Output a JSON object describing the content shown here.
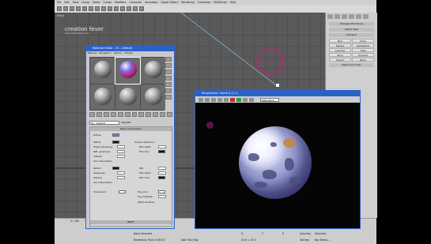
{
  "menubar": {
    "items": [
      "File",
      "Edit",
      "Tools",
      "Group",
      "Views",
      "Create",
      "Modifiers",
      "Character",
      "Animation",
      "Graph Editors",
      "Rendering",
      "Customize",
      "MAXScript",
      "Help"
    ]
  },
  "viewport": {
    "label": "Front",
    "logo_text": "creation fever",
    "logo_subtext": "www.creationfever.com"
  },
  "command_panel": {
    "dropdown": "Standard Primitives",
    "section": "Object Type",
    "autogrid": "AutoGrid",
    "buttons": [
      "Box",
      "Cone",
      "Sphere",
      "GeoSphere",
      "Cylinder",
      "Tube",
      "Torus",
      "Pyramid",
      "Teapot",
      "Plane"
    ],
    "section2": "Name and Color"
  },
  "material_editor": {
    "title": "Material Editor - 01 - Default",
    "menu": [
      "Material",
      "Navigation",
      "Options",
      "Utilities"
    ],
    "name_field": "01 - Default",
    "type_tag": "VRayMtl",
    "rollout_basic": "Basic parameters",
    "diffuse_label": "Diffuse",
    "reflect_label": "Reflect",
    "hilight_label": "Hilight glossiness",
    "refl_gloss_label": "Refl. glossiness",
    "subdivs_label": "Subdivs",
    "fresnel_label": "Fresnel reflections",
    "max_depth_label": "Max depth",
    "exit_color_label": "Exit color",
    "use_interp_label": "Use interpolation",
    "refract_label": "Refract",
    "ior_label": "IOR",
    "glossiness_label": "Glossiness",
    "translucent_label": "Translucent",
    "fog_color_label": "Fog color",
    "fog_mult_label": "Fog multiplier",
    "affect_shadows_label": "Affect shadows",
    "brdf_label": "BRDF",
    "values": {
      "hilight": "1.0",
      "refl_gloss": "1.0",
      "subdivs": "8",
      "max_depth": "5",
      "ior": "1.6",
      "gloss2": "1.0",
      "subdivs2": "8",
      "max_depth2": "5",
      "fog_mult": "1.0"
    }
  },
  "perspective": {
    "title": "Perspective, frame 0 (1:1)",
    "field": "RGB Alpha"
  },
  "status": {
    "frame": "0 / 100",
    "selected": "None Selected",
    "rendering_time": "Rendering Time: 0:00:03",
    "x": "X",
    "y": "Y",
    "z": "Z",
    "grid": "Grid = 10.0",
    "auto_key": "Auto Key",
    "set_key": "Set Key",
    "key_filters": "Key Filters...",
    "add_time_tag": "Add Time Tag",
    "selected_dd": "Selected"
  },
  "colors": {
    "accent": "#2a62c9",
    "panel": "#cfcfcf",
    "viewport": "#5a5a5a",
    "pink": "#c21f7a"
  }
}
